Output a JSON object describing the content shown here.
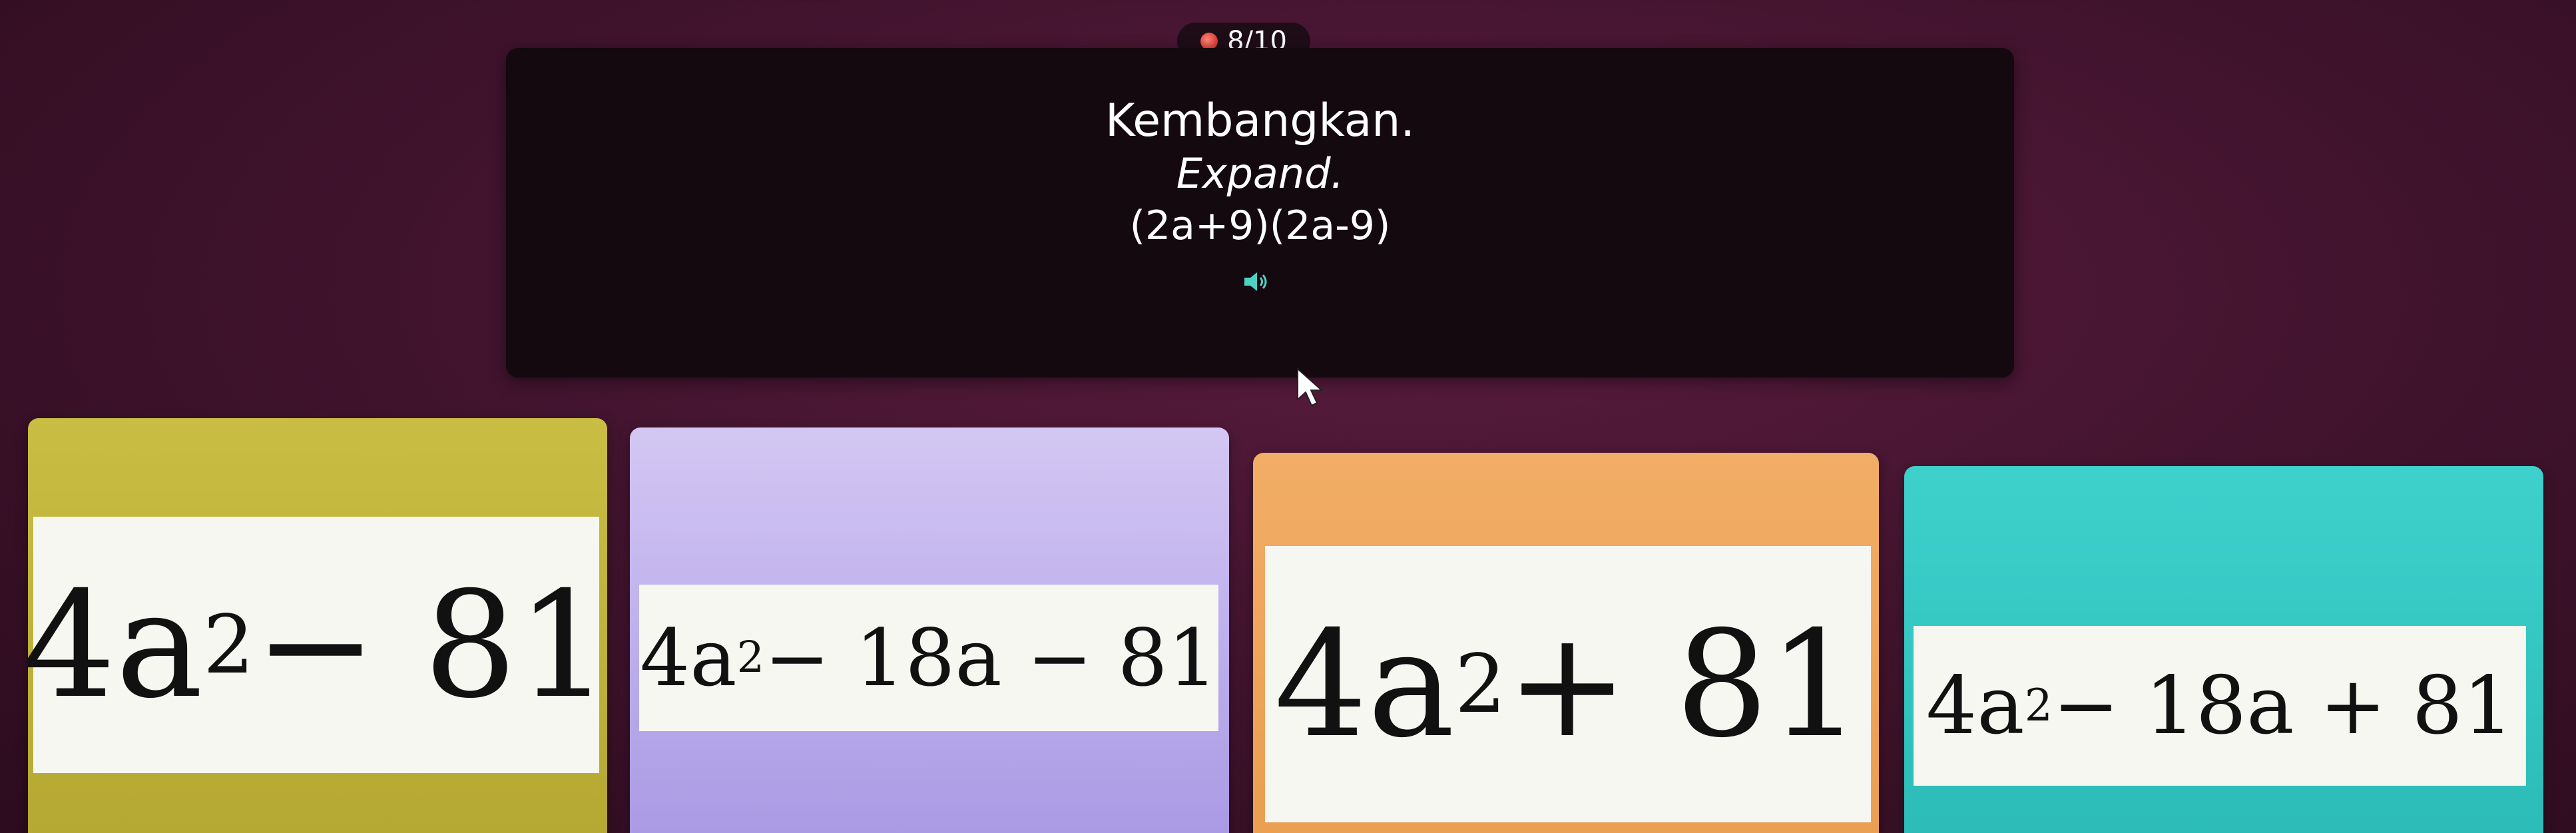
{
  "header": {
    "progress": "8/10"
  },
  "question": {
    "title": "Kembangkan.",
    "subtitle": "Expand.",
    "expression": "(2a+9)(2a-9)",
    "audio_icon": "speaker-icon"
  },
  "options": [
    {
      "base": "4a",
      "exp": "2",
      "rest": " − 81",
      "color": "#c2b53a"
    },
    {
      "base": "4a",
      "exp": "2",
      "rest": " − 18a − 81",
      "color": "#b9aaea"
    },
    {
      "base": "4a",
      "exp": "2",
      "rest": " + 81",
      "color": "#efa75e"
    },
    {
      "base": "4a",
      "exp": "2",
      "rest": " − 18a + 81",
      "color": "#35c7c2"
    }
  ]
}
